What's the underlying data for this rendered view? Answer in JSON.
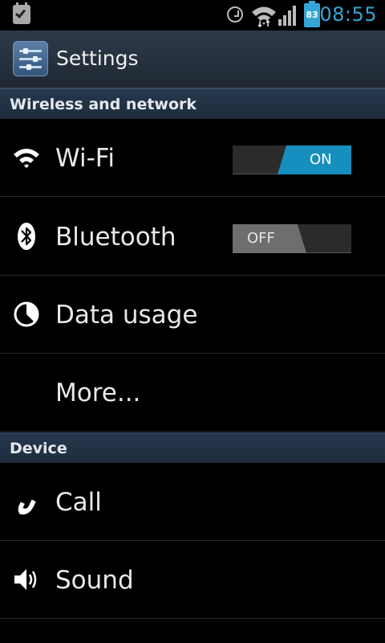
{
  "status_bar": {
    "battery_level": "83",
    "time": "08:55",
    "time_color": "#35a5d6"
  },
  "action_bar": {
    "icon": "settings-sliders-icon",
    "title": "Settings"
  },
  "sections": [
    {
      "header": "Wireless and network",
      "items": [
        {
          "label": "Wi-Fi",
          "icon": "wifi-icon",
          "toggle": "ON"
        },
        {
          "label": "Bluetooth",
          "icon": "bluetooth-icon",
          "toggle": "OFF"
        },
        {
          "label": "Data usage",
          "icon": "data-usage-icon"
        },
        {
          "label": "More..."
        }
      ]
    },
    {
      "header": "Device",
      "items": [
        {
          "label": "Call",
          "icon": "phone-icon"
        },
        {
          "label": "Sound",
          "icon": "speaker-icon"
        }
      ]
    }
  ],
  "colors": {
    "accent": "#35a5d6",
    "toggle_on": "#168fbf",
    "section_header_bg": "#1e2c3d"
  }
}
